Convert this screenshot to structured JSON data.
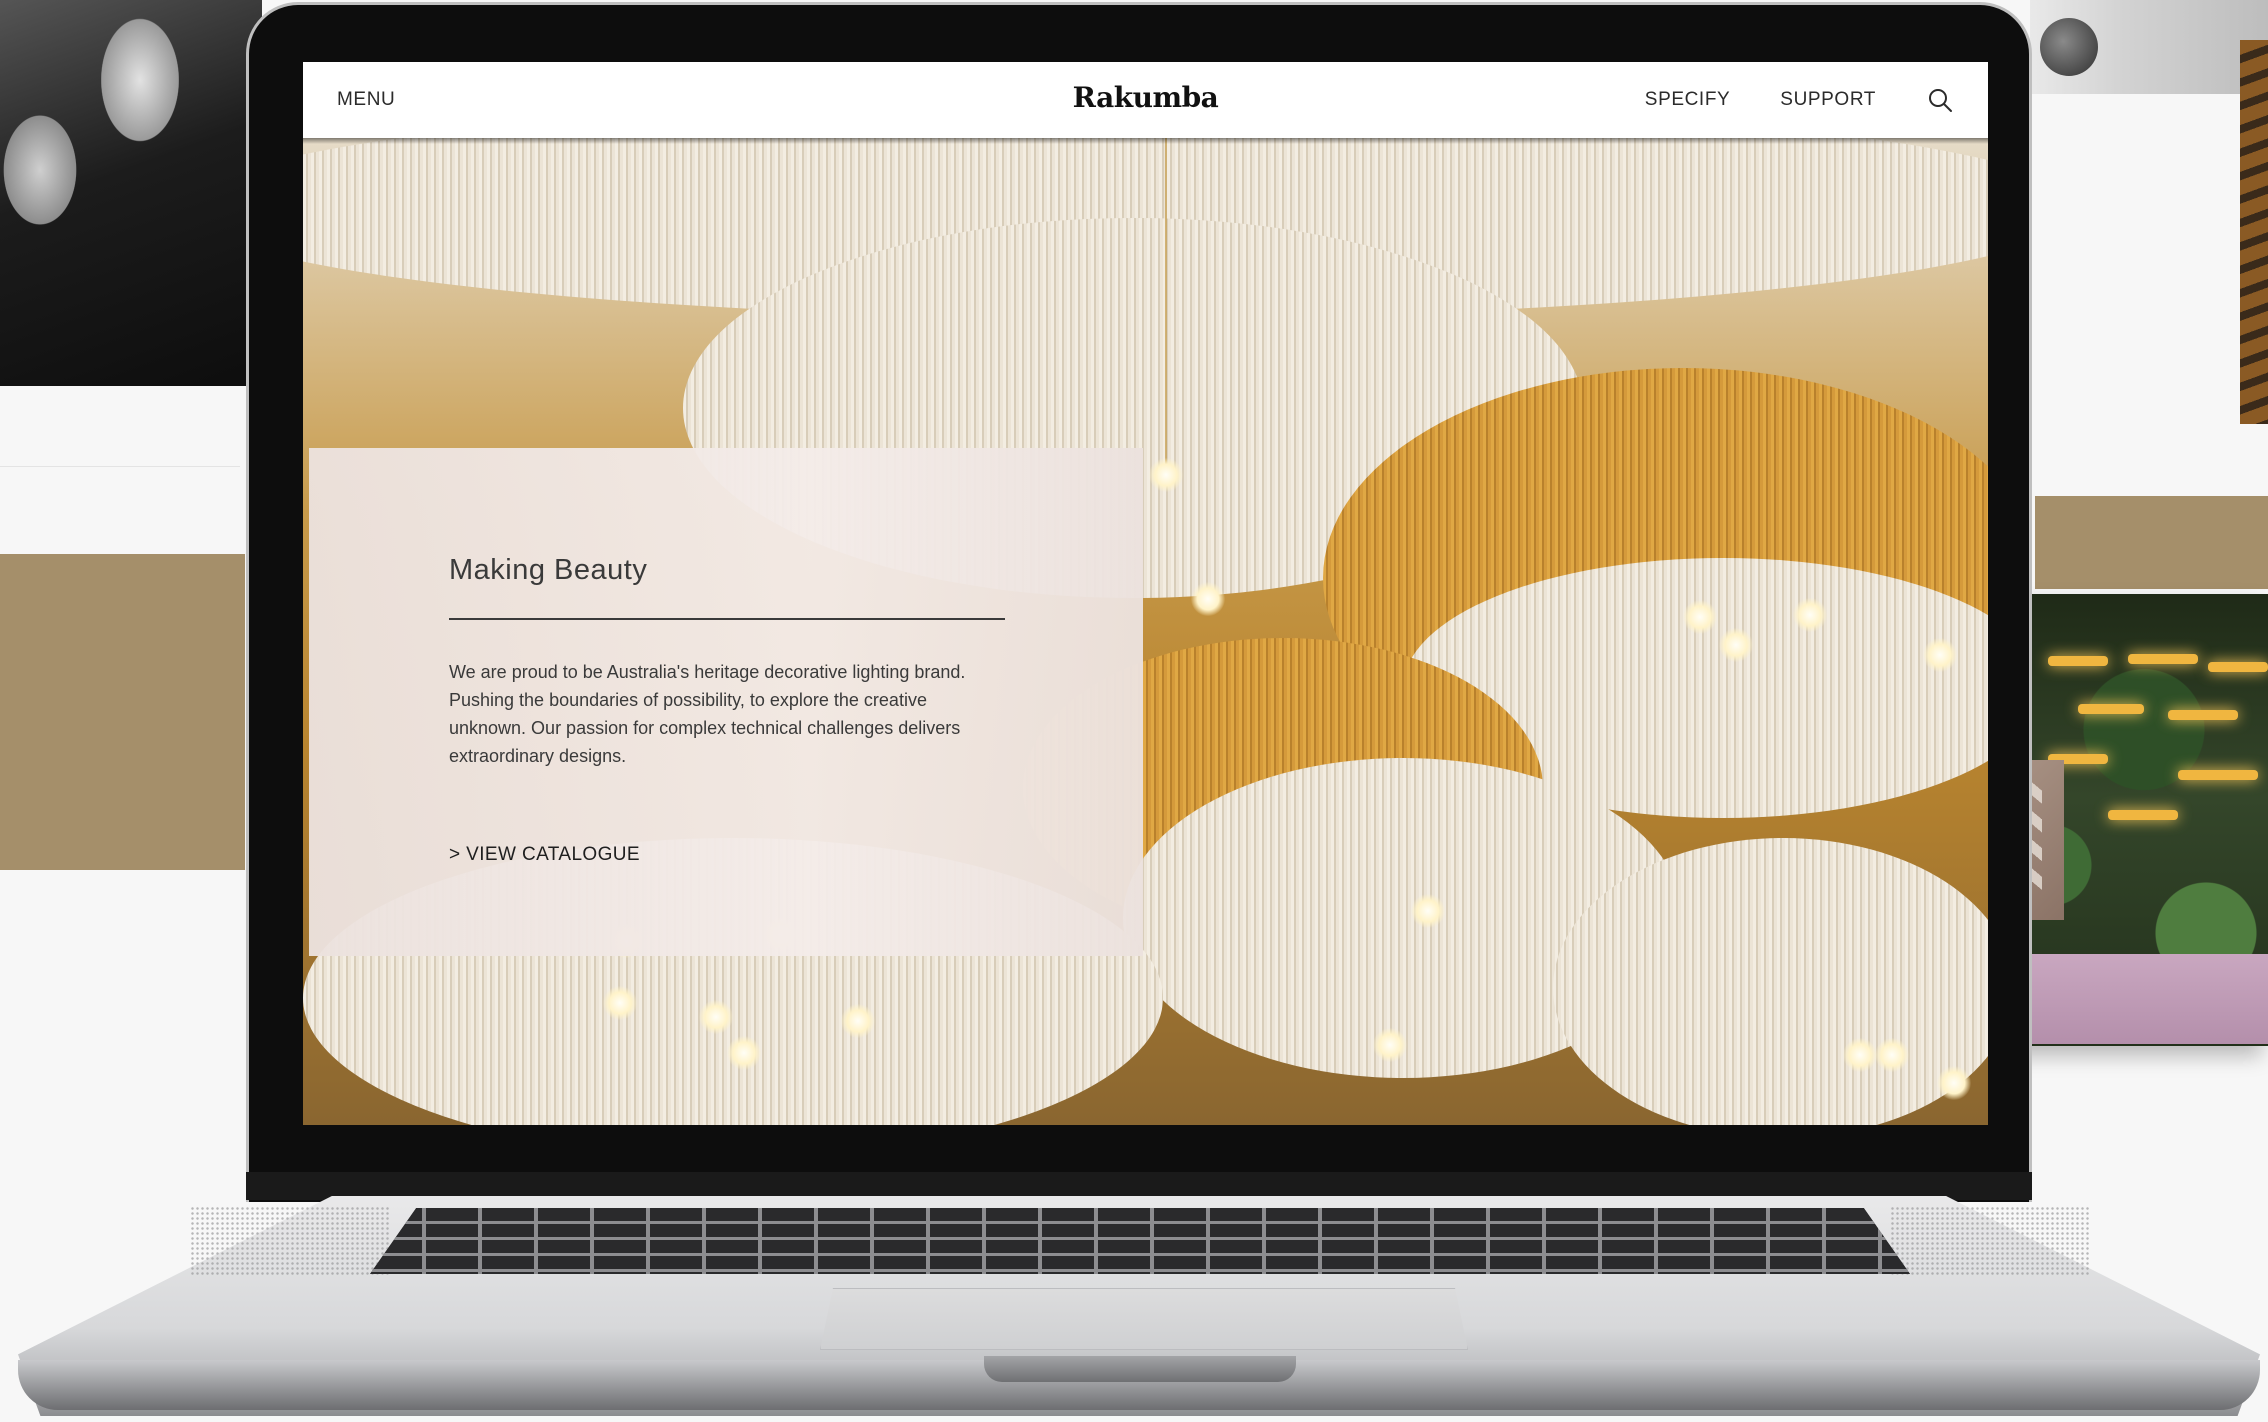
{
  "nav": {
    "menu_label": "MENU",
    "brand": "Rakumba",
    "specify_label": "SPECIFY",
    "support_label": "SUPPORT",
    "search_icon": "search-icon"
  },
  "hero": {
    "title": "Making Beauty",
    "body": "We are proud to be Australia's heritage decorative lighting brand. Pushing the boundaries of possibility, to explore the creative unknown. Our passion for complex technical challenges delivers extraordinary designs.",
    "cta": "> VIEW CATALOGUE"
  },
  "colors": {
    "accent_tan": "#a58f6a",
    "text_dark": "#3a3a3a",
    "card_bg": "#efe6e3"
  }
}
